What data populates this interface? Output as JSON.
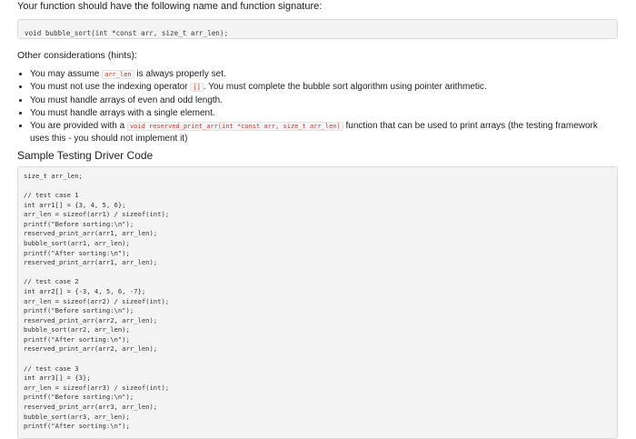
{
  "intro": "Your function should have the following name and function signature:",
  "signature": "void bubble_sort(int *const arr, size_t arr_len);",
  "hints_title": "Other considerations (hints):",
  "hints": [
    {
      "pre": "You may assume ",
      "code": "arr_len",
      "post": " is always properly set."
    },
    {
      "pre": "You must not use the indexing operator ",
      "code": "[]",
      "post": ". You must complete the bubble sort algorithm using pointer arithmetic."
    },
    {
      "pre": "You must handle arrays of even and odd length.",
      "code": "",
      "post": ""
    },
    {
      "pre": "You must handle arrays with a single element.",
      "code": "",
      "post": ""
    },
    {
      "pre": "You are provided with a ",
      "code": "void reserved_print_arr(int *const arr, size_t arr_len)",
      "post": " function that can be used to print arrays (the testing framework uses this - you should not implement it)"
    }
  ],
  "section_title": "Sample Testing Driver Code",
  "code_lines": [
    "size_t arr_len;",
    "",
    "// test case 1",
    "int arr1[] = {3, 4, 5, 6};",
    "arr_len = sizeof(arr1) / sizeof(int);",
    "printf(\"Before sorting:\\n\");",
    "reserved_print_arr(arr1, arr_len);",
    "bubble_sort(arr1, arr_len);",
    "printf(\"After sorting:\\n\");",
    "reserved_print_arr(arr1, arr_len);",
    "",
    "// test case 2",
    "int arr2[] = {-3, 4, 5, 6, -7};",
    "arr_len = sizeof(arr2) / sizeof(int);",
    "printf(\"Before sorting:\\n\");",
    "reserved_print_arr(arr2, arr_len);",
    "bubble_sort(arr2, arr_len);",
    "printf(\"After sorting:\\n\");",
    "reserved_print_arr(arr2, arr_len);",
    "",
    "// test case 3",
    "int arr3[] = {3};",
    "arr_len = sizeof(arr3) / sizeof(int);",
    "printf(\"Before sorting:\\n\");",
    "reserved_print_arr(arr3, arr_len);",
    "bubble_sort(arr3, arr_len);",
    "printf(\"After sorting:\\n\");"
  ]
}
